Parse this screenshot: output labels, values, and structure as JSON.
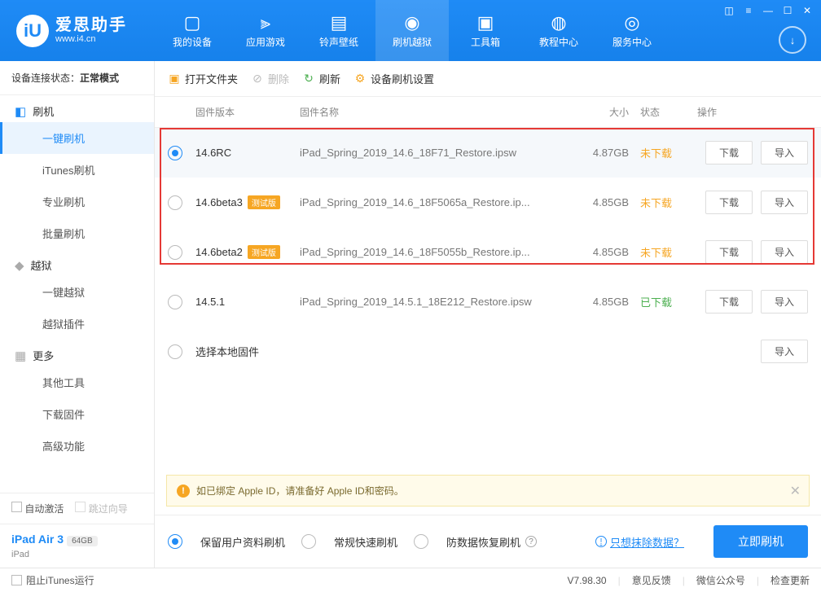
{
  "logo": {
    "title": "爱思助手",
    "sub": "www.i4.cn"
  },
  "nav": [
    "我的设备",
    "应用游戏",
    "铃声壁纸",
    "刷机越狱",
    "工具箱",
    "教程中心",
    "服务中心"
  ],
  "sidebar": {
    "status_label": "设备连接状态：",
    "status_value": "正常模式",
    "flash": {
      "title": "刷机",
      "items": [
        "一键刷机",
        "iTunes刷机",
        "专业刷机",
        "批量刷机"
      ]
    },
    "jailbreak": {
      "title": "越狱",
      "items": [
        "一键越狱",
        "越狱插件"
      ]
    },
    "more": {
      "title": "更多",
      "items": [
        "其他工具",
        "下载固件",
        "高级功能"
      ]
    },
    "auto_activate": "自动激活",
    "skip_guide": "跳过向导",
    "device": {
      "name": "iPad Air 3",
      "storage": "64GB",
      "type": "iPad"
    }
  },
  "toolbar": {
    "open": "打开文件夹",
    "delete": "删除",
    "refresh": "刷新",
    "settings": "设备刷机设置"
  },
  "columns": {
    "version": "固件版本",
    "name": "固件名称",
    "size": "大小",
    "status": "状态",
    "ops": "操作"
  },
  "rows": [
    {
      "ver": "14.6RC",
      "beta": false,
      "name": "iPad_Spring_2019_14.6_18F71_Restore.ipsw",
      "size": "4.87GB",
      "status": "未下载",
      "st": "orange",
      "dl": true,
      "imp": true,
      "sel": true
    },
    {
      "ver": "14.6beta3",
      "beta": true,
      "name": "iPad_Spring_2019_14.6_18F5065a_Restore.ip...",
      "size": "4.85GB",
      "status": "未下载",
      "st": "orange",
      "dl": true,
      "imp": true,
      "sel": false
    },
    {
      "ver": "14.6beta2",
      "beta": true,
      "name": "iPad_Spring_2019_14.6_18F5055b_Restore.ip...",
      "size": "4.85GB",
      "status": "未下载",
      "st": "orange",
      "dl": true,
      "imp": true,
      "sel": false
    },
    {
      "ver": "14.5.1",
      "beta": false,
      "name": "iPad_Spring_2019_14.5.1_18E212_Restore.ipsw",
      "size": "4.85GB",
      "status": "已下载",
      "st": "green",
      "dl": true,
      "imp": true,
      "sel": false
    },
    {
      "ver": "选择本地固件",
      "beta": false,
      "name": "",
      "size": "",
      "status": "",
      "st": "",
      "dl": false,
      "imp": true,
      "sel": false
    }
  ],
  "beta_badge": "测试版",
  "buttons": {
    "download": "下载",
    "import": "导入"
  },
  "notice": "如已绑定 Apple ID，请准备好 Apple ID和密码。",
  "options": {
    "keep": "保留用户资料刷机",
    "normal": "常规快速刷机",
    "anti": "防数据恢复刷机",
    "erase": "只想抹除数据？",
    "go": "立即刷机"
  },
  "footer": {
    "block": "阻止iTunes运行",
    "version": "V7.98.30",
    "feedback": "意见反馈",
    "wechat": "微信公众号",
    "update": "检查更新"
  }
}
